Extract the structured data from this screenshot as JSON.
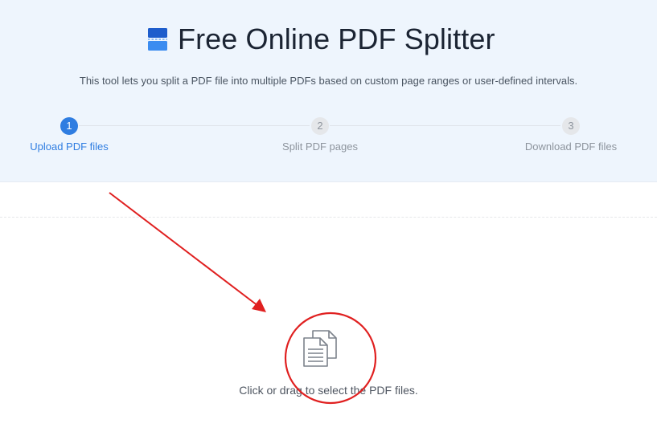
{
  "header": {
    "title": "Free Online PDF Splitter",
    "description": "This tool lets you split a PDF file into multiple PDFs based on custom page ranges or user-defined intervals.",
    "logo_icon": "pdf-split-logo-icon"
  },
  "steps": [
    {
      "number": "1",
      "label": "Upload PDF files",
      "state": "active"
    },
    {
      "number": "2",
      "label": "Split PDF pages",
      "state": "inactive"
    },
    {
      "number": "3",
      "label": "Download PDF files",
      "state": "inactive"
    }
  ],
  "upload": {
    "prompt": "Click or drag to select the PDF files.",
    "icon": "files-icon"
  },
  "colors": {
    "hero_background": "#eef5fd",
    "accent": "#2f7de1",
    "annotation": "#e02020"
  }
}
